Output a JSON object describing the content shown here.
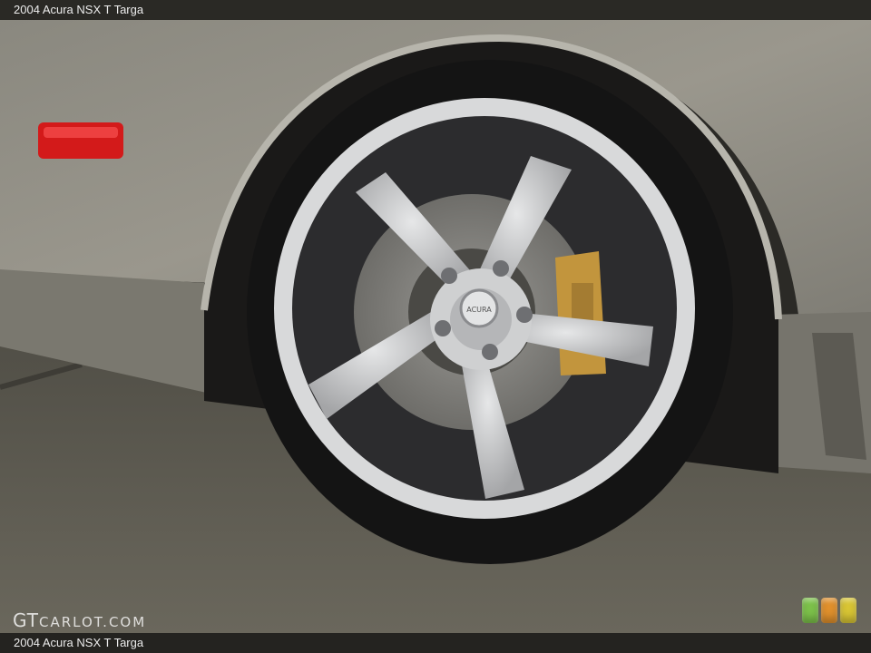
{
  "header": {
    "title": "2004 Acura NSX T Targa"
  },
  "footer": {
    "caption": "2004 Acura NSX T Targa"
  },
  "watermark": {
    "brand": "GT",
    "rest": "CARLOT.COM"
  },
  "wheel_cap_text": "ACURA",
  "colors": {
    "body_paint": "#8e8c84",
    "floor": "#5f5c52",
    "tire": "#141414",
    "rim": "#c9cacb",
    "caliper": "#c2953d",
    "marker_light": "#d31a1a",
    "light_green": "#7cc14a",
    "light_orange": "#e0902c",
    "light_yellow": "#d8c534"
  },
  "icons": [
    "green-status-light",
    "orange-status-light",
    "yellow-status-light"
  ]
}
